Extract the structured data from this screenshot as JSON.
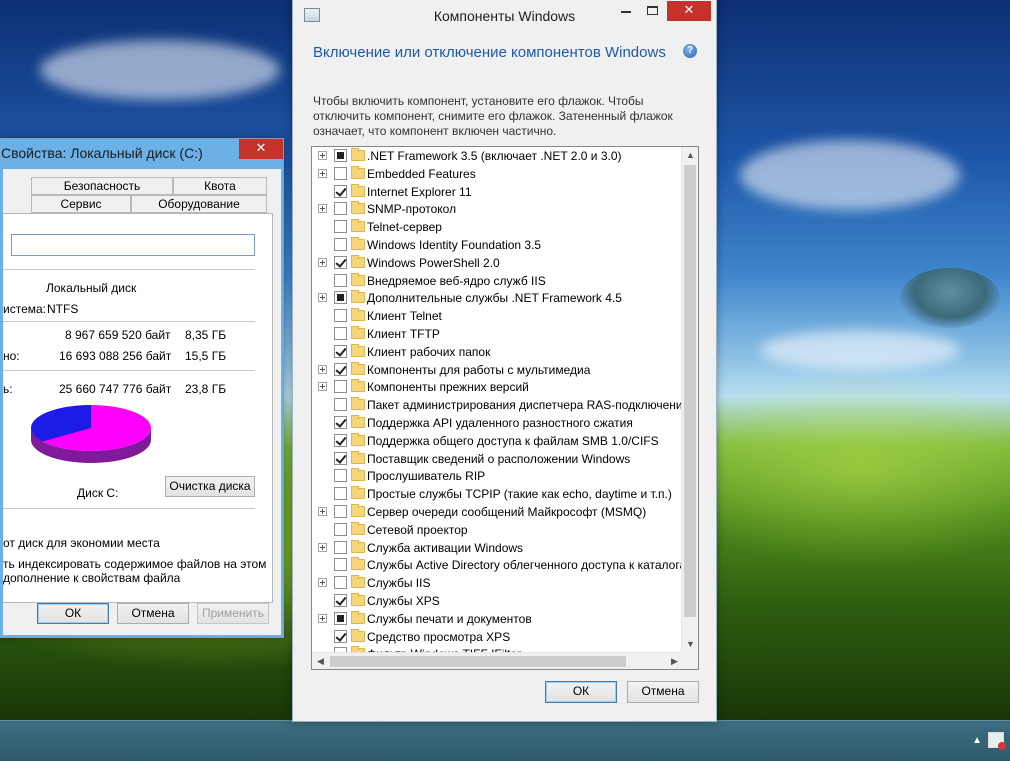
{
  "properties_window": {
    "title": "Свойства: Локальный диск (С:)",
    "close_glyph": "✕",
    "tabs_row1": [
      "Безопасность",
      "Квота"
    ],
    "tabs_row2": [
      "Сервис",
      "Оборудование"
    ],
    "drive_type": "Локальный диск",
    "fs_label": "истема:",
    "fs_value": "NTFS",
    "used_bytes": "8 967 659 520 байт",
    "used_size": "8,35 ГБ",
    "free_label": "но:",
    "free_bytes": "16 693 088 256 байт",
    "free_size": "15,5 ГБ",
    "capacity_label": "ь:",
    "capacity_bytes": "25 660 747 776 байт",
    "capacity_size": "23,8 ГБ",
    "disk_label": "Диск С:",
    "cleanup_button": "Очистка диска",
    "compress_text": "от диск для экономии места",
    "index_text_1": "ть индексировать содержимое файлов на этом",
    "index_text_2": "дополнение к свойствам файла",
    "ok": "ОК",
    "cancel": "Отмена",
    "apply": "Применить",
    "pie": {
      "used_fraction": 0.35,
      "used_color": "#1c1ce6",
      "free_color": "#ff00ff"
    }
  },
  "features_window": {
    "title": "Компоненты Windows",
    "close_glyph": "✕",
    "heading": "Включение или отключение компонентов Windows",
    "description": "Чтобы включить компонент, установите его флажок. Чтобы отключить компонент, снимите его флажок. Затененный флажок означает, что компонент включен частично.",
    "help_glyph": "?",
    "ok": "ОК",
    "cancel": "Отмена",
    "items": [
      {
        "label": ".NET Framework 3.5 (включает .NET 2.0 и 3.0)",
        "expandable": true,
        "state": "partial"
      },
      {
        "label": "Embedded Features",
        "expandable": true,
        "state": "unchecked"
      },
      {
        "label": "Internet Explorer 11",
        "expandable": false,
        "state": "checked"
      },
      {
        "label": "SNMP-протокол",
        "expandable": true,
        "state": "unchecked"
      },
      {
        "label": "Telnet-сервер",
        "expandable": false,
        "state": "unchecked"
      },
      {
        "label": "Windows Identity Foundation 3.5",
        "expandable": false,
        "state": "unchecked"
      },
      {
        "label": "Windows PowerShell 2.0",
        "expandable": true,
        "state": "checked"
      },
      {
        "label": "Внедряемое веб-ядро служб IIS",
        "expandable": false,
        "state": "unchecked"
      },
      {
        "label": "Дополнительные службы .NET Framework 4.5",
        "expandable": true,
        "state": "partial"
      },
      {
        "label": "Клиент Telnet",
        "expandable": false,
        "state": "unchecked"
      },
      {
        "label": "Клиент TFTP",
        "expandable": false,
        "state": "unchecked"
      },
      {
        "label": "Клиент рабочих папок",
        "expandable": false,
        "state": "checked"
      },
      {
        "label": "Компоненты для работы с мультимедиа",
        "expandable": true,
        "state": "checked"
      },
      {
        "label": "Компоненты прежних версий",
        "expandable": true,
        "state": "unchecked"
      },
      {
        "label": "Пакет администрирования диспетчера RAS-подключений",
        "expandable": false,
        "state": "unchecked"
      },
      {
        "label": "Поддержка API удаленного разностного сжатия",
        "expandable": false,
        "state": "checked"
      },
      {
        "label": "Поддержка общего доступа к файлам SMB 1.0/CIFS",
        "expandable": false,
        "state": "checked"
      },
      {
        "label": "Поставщик сведений о расположении Windows",
        "expandable": false,
        "state": "checked"
      },
      {
        "label": "Прослушиватель RIP",
        "expandable": false,
        "state": "unchecked"
      },
      {
        "label": "Простые службы TCPIP (такие как echo, daytime и т.п.)",
        "expandable": false,
        "state": "unchecked"
      },
      {
        "label": "Сервер очереди сообщений Майкрософт (MSMQ)",
        "expandable": true,
        "state": "unchecked"
      },
      {
        "label": "Сетевой проектор",
        "expandable": false,
        "state": "unchecked"
      },
      {
        "label": "Служба активации Windows",
        "expandable": true,
        "state": "unchecked"
      },
      {
        "label": "Службы Active Directory облегченного доступа к каталогам",
        "expandable": false,
        "state": "unchecked"
      },
      {
        "label": "Службы IIS",
        "expandable": true,
        "state": "unchecked"
      },
      {
        "label": "Службы XPS",
        "expandable": false,
        "state": "checked"
      },
      {
        "label": "Службы печати и документов",
        "expandable": true,
        "state": "partial"
      },
      {
        "label": "Средство просмотра XPS",
        "expandable": false,
        "state": "checked"
      },
      {
        "label": "Фильтр Windows TIFF IFilter",
        "expandable": false,
        "state": "unchecked"
      }
    ]
  }
}
